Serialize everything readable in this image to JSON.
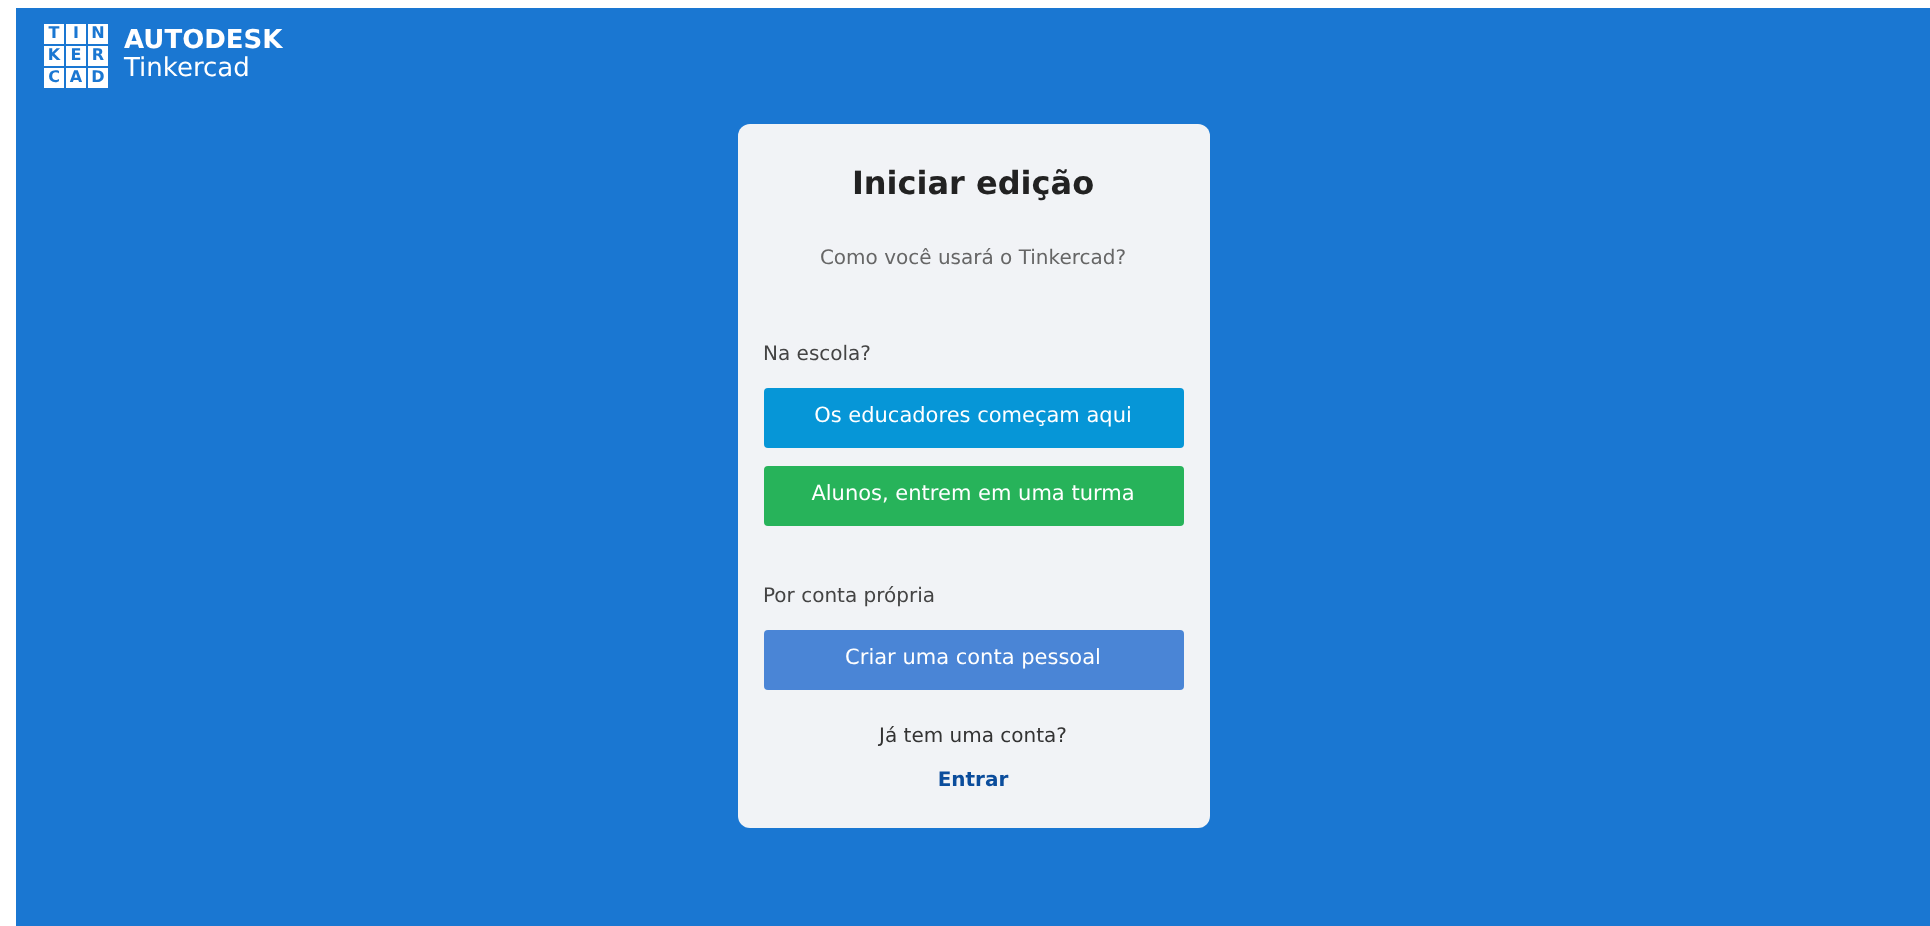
{
  "logo": {
    "tiles": [
      [
        "T",
        "I",
        "N"
      ],
      [
        "K",
        "E",
        "R"
      ],
      [
        "C",
        "A",
        "D"
      ]
    ],
    "brand": "AUTODESK",
    "product": "Tinkercad"
  },
  "card": {
    "title": "Iniciar edição",
    "subtitle": "Como você usará o Tinkercad?",
    "sections": [
      {
        "label": "Na escola?",
        "buttons": [
          {
            "label": "Os educadores começam aqui",
            "color": "#0696d7"
          },
          {
            "label": "Alunos, entrem em uma turma",
            "color": "#27b35a"
          }
        ]
      },
      {
        "label": "Por conta própria",
        "buttons": [
          {
            "label": "Criar uma conta pessoal",
            "color": "#4a85d6"
          }
        ]
      }
    ],
    "footer_text": "Já tem uma conta?",
    "footer_link": "Entrar"
  }
}
